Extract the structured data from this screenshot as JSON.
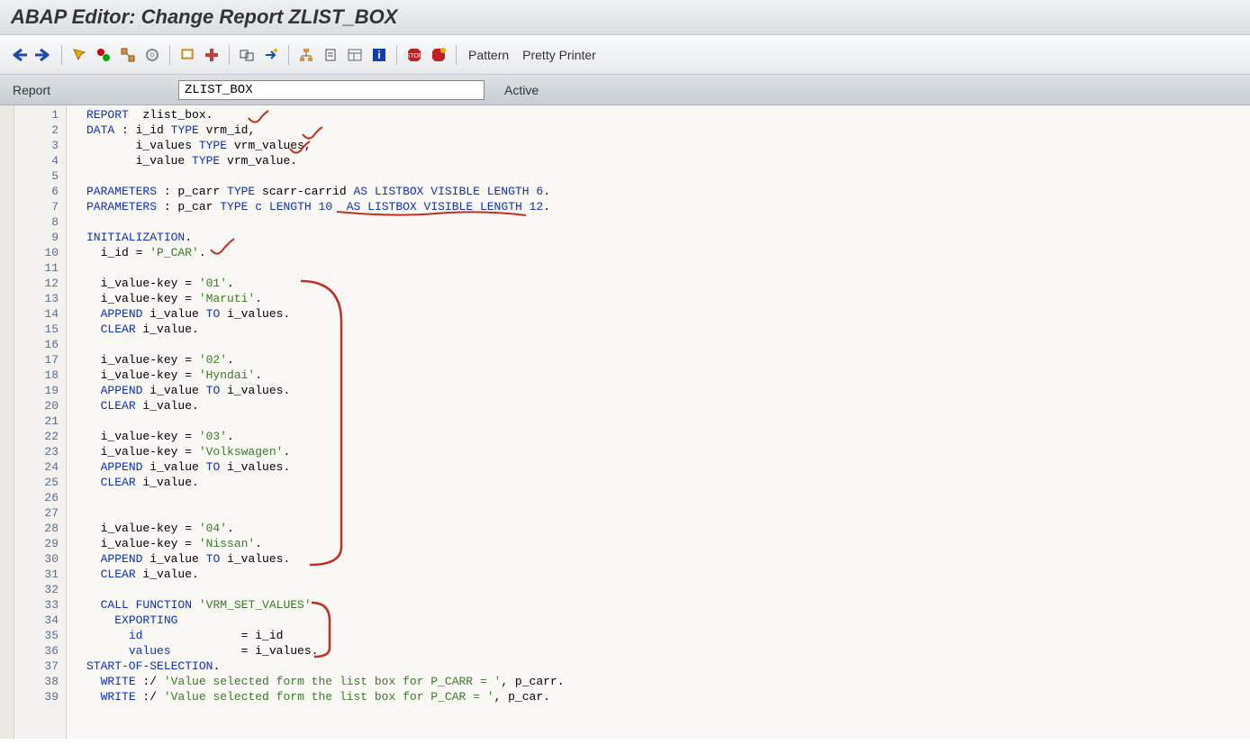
{
  "title": "ABAP Editor: Change Report ZLIST_BOX",
  "toolbar": {
    "pattern": "Pattern",
    "pretty_printer": "Pretty Printer",
    "icons": [
      "back-icon",
      "forward-icon",
      "activate-icon",
      "check-icon",
      "where-used-icon",
      "pretzel-icon",
      "display-icon",
      "breakpoint-icon",
      "execute-icon",
      "direct-icon",
      "hierarchy-icon",
      "insert-icon",
      "layout-icon",
      "help-icon",
      "stop1-icon",
      "stop2-icon"
    ]
  },
  "report_bar": {
    "label": "Report",
    "value": "ZLIST_BOX",
    "status": "Active"
  },
  "code": {
    "lines": [
      [
        {
          "t": "REPORT",
          "c": "kw"
        },
        {
          "t": "  zlist_box."
        }
      ],
      [
        {
          "t": "DATA",
          "c": "kw"
        },
        {
          "t": " : i_id "
        },
        {
          "t": "TYPE",
          "c": "kw"
        },
        {
          "t": " vrm_id,"
        }
      ],
      [
        {
          "t": "       i_values "
        },
        {
          "t": "TYPE",
          "c": "kw"
        },
        {
          "t": " vrm_values,"
        }
      ],
      [
        {
          "t": "       i_value "
        },
        {
          "t": "TYPE",
          "c": "kw"
        },
        {
          "t": " vrm_value."
        }
      ],
      [],
      [
        {
          "t": "PARAMETERS",
          "c": "kw"
        },
        {
          "t": " : p_carr "
        },
        {
          "t": "TYPE",
          "c": "kw"
        },
        {
          "t": " scarr-carrid "
        },
        {
          "t": "AS LISTBOX VISIBLE LENGTH",
          "c": "kw"
        },
        {
          "t": " "
        },
        {
          "t": "6",
          "c": "lit"
        },
        {
          "t": "."
        }
      ],
      [
        {
          "t": "PARAMETERS",
          "c": "kw"
        },
        {
          "t": " : p_car "
        },
        {
          "t": "TYPE",
          "c": "kw"
        },
        {
          "t": " "
        },
        {
          "t": "c",
          "c": "kw"
        },
        {
          "t": " "
        },
        {
          "t": "LENGTH",
          "c": "kw"
        },
        {
          "t": " "
        },
        {
          "t": "10",
          "c": "lit"
        },
        {
          "t": "  "
        },
        {
          "t": "AS LISTBOX VISIBLE LENGTH",
          "c": "kw"
        },
        {
          "t": " "
        },
        {
          "t": "12",
          "c": "lit"
        },
        {
          "t": "."
        }
      ],
      [],
      [
        {
          "t": "INITIALIZATION",
          "c": "kw"
        },
        {
          "t": "."
        }
      ],
      [
        {
          "t": "  i_id = "
        },
        {
          "t": "'P_CAR'",
          "c": "str"
        },
        {
          "t": "."
        }
      ],
      [],
      [
        {
          "t": "  i_value-key = "
        },
        {
          "t": "'01'",
          "c": "str"
        },
        {
          "t": "."
        }
      ],
      [
        {
          "t": "  i_value-key = "
        },
        {
          "t": "'Maruti'",
          "c": "str"
        },
        {
          "t": "."
        }
      ],
      [
        {
          "t": "  "
        },
        {
          "t": "APPEND",
          "c": "kw"
        },
        {
          "t": " i_value "
        },
        {
          "t": "TO",
          "c": "kw"
        },
        {
          "t": " i_values."
        }
      ],
      [
        {
          "t": "  "
        },
        {
          "t": "CLEAR",
          "c": "kw"
        },
        {
          "t": " i_value."
        }
      ],
      [],
      [
        {
          "t": "  i_value-key = "
        },
        {
          "t": "'02'",
          "c": "str"
        },
        {
          "t": "."
        }
      ],
      [
        {
          "t": "  i_value-key = "
        },
        {
          "t": "'Hyndai'",
          "c": "str"
        },
        {
          "t": "."
        }
      ],
      [
        {
          "t": "  "
        },
        {
          "t": "APPEND",
          "c": "kw"
        },
        {
          "t": " i_value "
        },
        {
          "t": "TO",
          "c": "kw"
        },
        {
          "t": " i_values."
        }
      ],
      [
        {
          "t": "  "
        },
        {
          "t": "CLEAR",
          "c": "kw"
        },
        {
          "t": " i_value."
        }
      ],
      [],
      [
        {
          "t": "  i_value-key = "
        },
        {
          "t": "'03'",
          "c": "str"
        },
        {
          "t": "."
        }
      ],
      [
        {
          "t": "  i_value-key = "
        },
        {
          "t": "'Volkswagen'",
          "c": "str"
        },
        {
          "t": "."
        }
      ],
      [
        {
          "t": "  "
        },
        {
          "t": "APPEND",
          "c": "kw"
        },
        {
          "t": " i_value "
        },
        {
          "t": "TO",
          "c": "kw"
        },
        {
          "t": " i_values."
        }
      ],
      [
        {
          "t": "  "
        },
        {
          "t": "CLEAR",
          "c": "kw"
        },
        {
          "t": " i_value."
        }
      ],
      [],
      [],
      [
        {
          "t": "  i_value-key = "
        },
        {
          "t": "'04'",
          "c": "str"
        },
        {
          "t": "."
        }
      ],
      [
        {
          "t": "  i_value-key = "
        },
        {
          "t": "'Nissan'",
          "c": "str"
        },
        {
          "t": "."
        }
      ],
      [
        {
          "t": "  "
        },
        {
          "t": "APPEND",
          "c": "kw"
        },
        {
          "t": " i_value "
        },
        {
          "t": "TO",
          "c": "kw"
        },
        {
          "t": " i_values."
        }
      ],
      [
        {
          "t": "  "
        },
        {
          "t": "CLEAR",
          "c": "kw"
        },
        {
          "t": " i_value."
        }
      ],
      [],
      [
        {
          "t": "  "
        },
        {
          "t": "CALL FUNCTION",
          "c": "kw"
        },
        {
          "t": " "
        },
        {
          "t": "'VRM_SET_VALUES'",
          "c": "str"
        }
      ],
      [
        {
          "t": "    "
        },
        {
          "t": "EXPORTING",
          "c": "kw"
        }
      ],
      [
        {
          "t": "      "
        },
        {
          "t": "id",
          "c": "kw"
        },
        {
          "t": "              = i_id"
        }
      ],
      [
        {
          "t": "      "
        },
        {
          "t": "values",
          "c": "kw"
        },
        {
          "t": "          = i_values."
        }
      ],
      [
        {
          "t": "START-OF-SELECTION",
          "c": "kw"
        },
        {
          "t": "."
        }
      ],
      [
        {
          "t": "  "
        },
        {
          "t": "WRITE",
          "c": "kw"
        },
        {
          "t": " :/ "
        },
        {
          "t": "'Value selected form the list box for P_CARR = '",
          "c": "str"
        },
        {
          "t": ", p_carr."
        }
      ],
      [
        {
          "t": "  "
        },
        {
          "t": "WRITE",
          "c": "kw"
        },
        {
          "t": " :/ "
        },
        {
          "t": "'Value selected form the list box for P_CAR = '",
          "c": "str"
        },
        {
          "t": ", p_car."
        }
      ]
    ],
    "highlighted_line_index": 31
  }
}
